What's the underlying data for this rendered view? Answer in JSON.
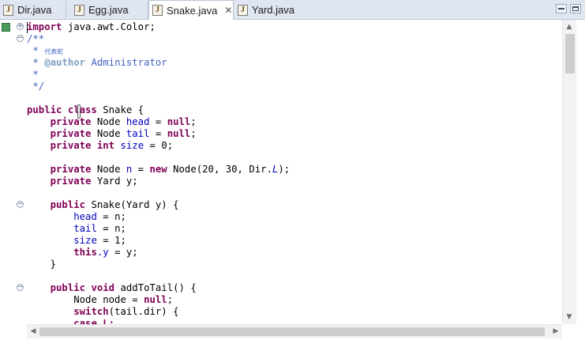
{
  "tabs": [
    {
      "label": "Dir.java",
      "icon": "java-file-icon",
      "active": false
    },
    {
      "label": "Egg.java",
      "icon": "java-file-icon",
      "active": false
    },
    {
      "label": "Snake.java",
      "icon": "java-file-icon",
      "active": true,
      "close": "✕"
    },
    {
      "label": "Yard.java",
      "icon": "java-file-icon",
      "active": false
    }
  ],
  "icon_letter": "J",
  "fold_collapsed": "+",
  "fold_expanded": "−",
  "code": {
    "l1_kw": "import",
    "l1_rest": " java.awt.Color;",
    "l2": "/**",
    "l3_star": " * ",
    "l3_cjk": "代表蛇",
    "l4_star": " * ",
    "l4_tag": "@author",
    "l4_rest": " Administrator",
    "l5": " *",
    "l6": " */",
    "l8_kw": "public class",
    "l8_rest": " Snake {",
    "private": "private",
    "node_type": " Node ",
    "head": "head",
    "tail": "tail",
    "size": "size",
    "eq": " = ",
    "null": "null",
    "semi": ";",
    "int": " int ",
    "zero": "0",
    "n": "n",
    "new": "new",
    "l13_rest": " Node(20, 30, Dir.",
    "L": "L",
    "l13_end": ");",
    "yard_decl": " Yard y;",
    "public": "public",
    "ctor": " Snake(Yard y) {",
    "one": "1",
    "this": "this",
    "dot_y": ".y",
    "assign_y": " = y;",
    "close_brace": "}",
    "void": " void",
    "method": " addToTail() {",
    "local_node": "Node node = ",
    "switch": "switch",
    "switch_rest": "(tail.dir) {",
    "case_partial": "case L:"
  },
  "arrows": {
    "up": "▲",
    "down": "▼",
    "left": "◀",
    "right": "▶"
  }
}
